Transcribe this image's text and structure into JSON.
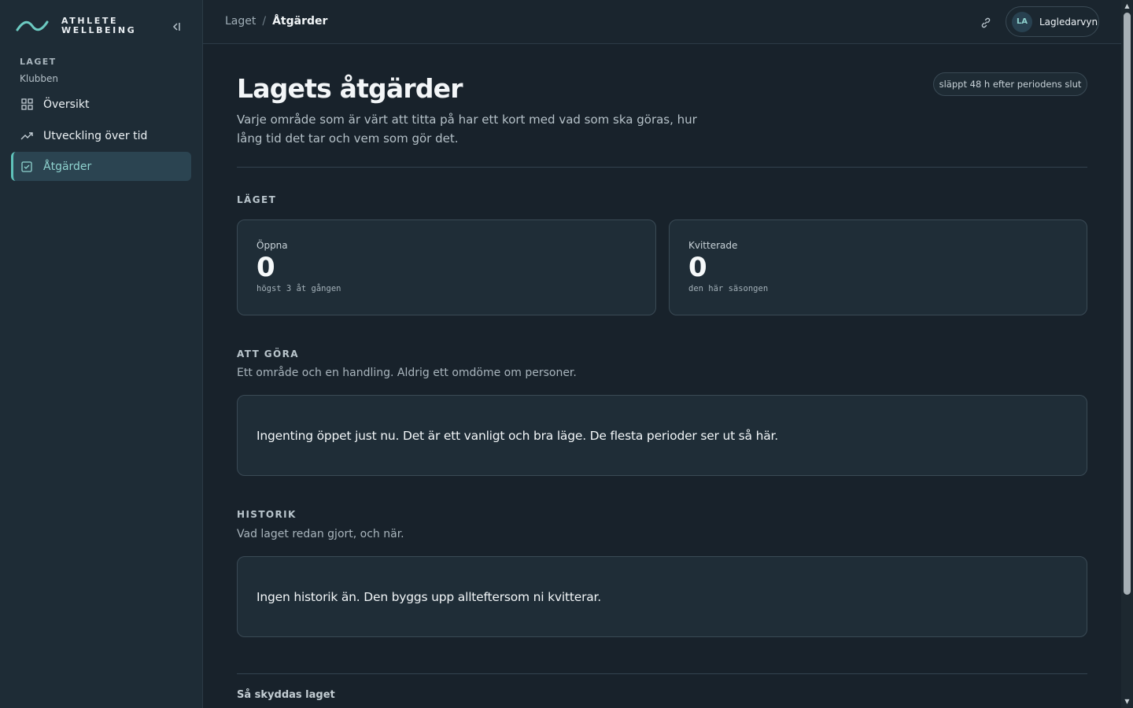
{
  "brand": {
    "line1": "ATHLETE",
    "line2": "WELLBEING",
    "logo_icon": "wave-icon"
  },
  "sidebar": {
    "section_label": "LAGET",
    "section_sub": "Klubben",
    "items": [
      {
        "label": "Översikt",
        "icon": "grid-icon",
        "active": false
      },
      {
        "label": "Utveckling över tid",
        "icon": "trend-icon",
        "active": false
      },
      {
        "label": "Åtgärder",
        "icon": "checkbox-icon",
        "active": true
      }
    ]
  },
  "topbar": {
    "breadcrumb": [
      "Laget",
      "Åtgärder"
    ],
    "breadcrumb_sep": "/",
    "user_initials": "LA",
    "user_name": "Lagledarvyn"
  },
  "page": {
    "title": "Lagets åtgärder",
    "release_badge": "släppt 48 h efter periodens slut",
    "description": "Varje område som är värt att titta på har ett kort med vad som ska göras, hur lång tid det tar och vem som gör det."
  },
  "status": {
    "label": "LÄGET",
    "cards": [
      {
        "label": "Öppna",
        "value": "0",
        "note": "högst 3 åt gången"
      },
      {
        "label": "Kvitterade",
        "value": "0",
        "note": "den här säsongen"
      }
    ]
  },
  "todo": {
    "label": "ATT GÖRA",
    "description": "Ett område och en handling. Aldrig ett omdöme om personer.",
    "empty_message": "Ingenting öppet just nu. Det är ett vanligt och bra läge. De flesta perioder ser ut så här."
  },
  "history": {
    "label": "HISTORIK",
    "description": "Vad laget redan gjort, och när.",
    "empty_message": "Ingen historik än. Den byggs upp allteftersom ni kvitterar."
  },
  "footer": {
    "title": "Så skyddas laget"
  },
  "colors": {
    "accent": "#5fc3bb",
    "background": "#18222b",
    "sidebar": "#1e2c36",
    "card": "#1f2d37"
  }
}
